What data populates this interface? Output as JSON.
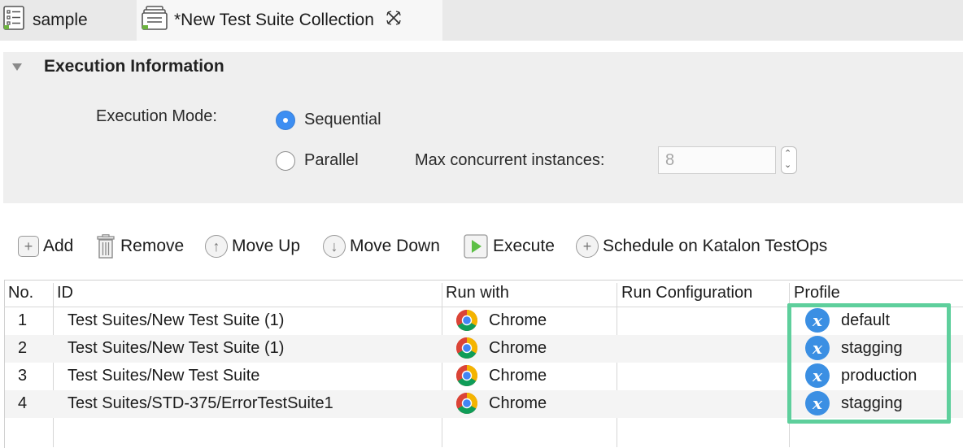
{
  "tabs": [
    {
      "label": "sample",
      "icon": "test-suite-icon",
      "active": false
    },
    {
      "label": "*New Test Suite Collection",
      "icon": "test-suite-collection-icon",
      "active": true
    }
  ],
  "execution": {
    "title": "Execution Information",
    "mode_label": "Execution Mode:",
    "sequential_label": "Sequential",
    "parallel_label": "Parallel",
    "selected_mode": "Sequential",
    "max_instances_label": "Max concurrent instances:",
    "max_instances_value": "8"
  },
  "toolbar": {
    "add": "Add",
    "remove": "Remove",
    "move_up": "Move Up",
    "move_down": "Move Down",
    "execute": "Execute",
    "schedule": "Schedule on Katalon TestOps"
  },
  "table": {
    "columns": [
      "No.",
      "ID",
      "Run with",
      "Run Configuration",
      "Profile"
    ],
    "rows": [
      {
        "no": "1",
        "id": "Test Suites/New Test Suite (1)",
        "run_with": "Chrome",
        "run_configuration": "",
        "profile": "default"
      },
      {
        "no": "2",
        "id": "Test Suites/New Test Suite (1)",
        "run_with": "Chrome",
        "run_configuration": "",
        "profile": "stagging"
      },
      {
        "no": "3",
        "id": "Test Suites/New Test Suite",
        "run_with": "Chrome",
        "run_configuration": "",
        "profile": "production"
      },
      {
        "no": "4",
        "id": "Test Suites/STD-375/ErrorTestSuite1",
        "run_with": "Chrome",
        "run_configuration": "",
        "profile": "stagging"
      }
    ]
  },
  "colors": {
    "accent": "#3d8ef2",
    "highlight": "#5ecf9c",
    "profile_icon": "#3b8fe3"
  }
}
